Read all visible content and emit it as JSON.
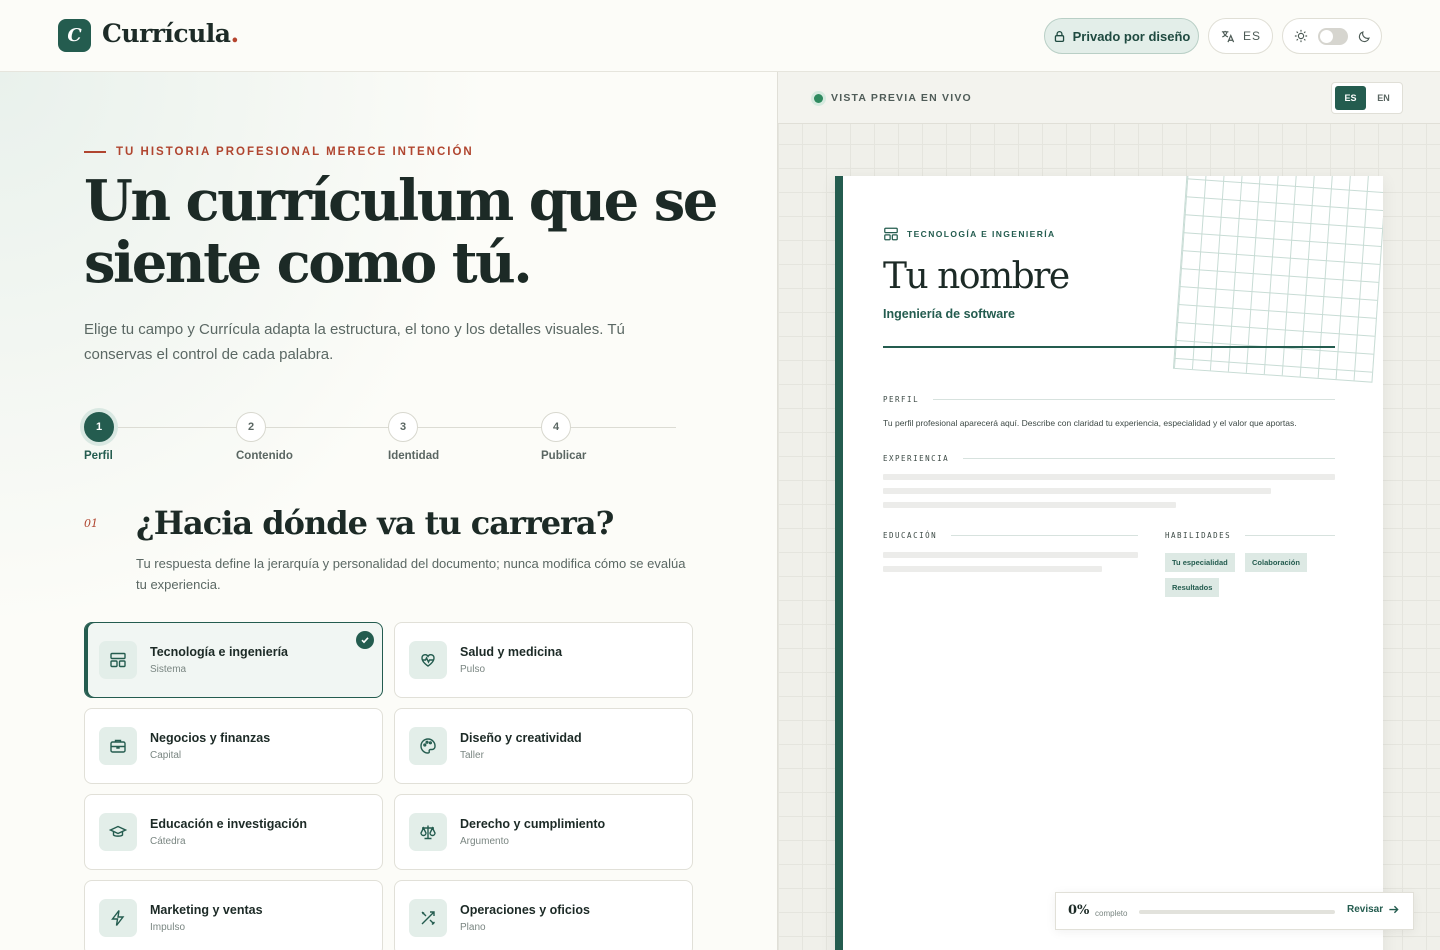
{
  "header": {
    "logo_mark": "C",
    "logo_text": "Currícula",
    "logo_dot": ".",
    "privacy_label": "Privado por diseño",
    "lang_code": "ES"
  },
  "hero": {
    "eyebrow": "TU HISTORIA PROFESIONAL MERECE INTENCIÓN",
    "title": "Un currículum que se siente como tú.",
    "subtitle": "Elige tu campo y Currícula adapta la estructura, el tono y los detalles visuales. Tú conservas el control de cada palabra."
  },
  "steps": [
    {
      "num": "1",
      "label": "Perfil",
      "active": true
    },
    {
      "num": "2",
      "label": "Contenido",
      "active": false
    },
    {
      "num": "3",
      "label": "Identidad",
      "active": false
    },
    {
      "num": "4",
      "label": "Publicar",
      "active": false
    }
  ],
  "question": {
    "num": "01",
    "title": "¿Hacia dónde va tu carrera?",
    "subtitle": "Tu respuesta define la jerarquía y personalidad del documento; nunca modifica cómo se evalúa tu experiencia."
  },
  "fields": [
    {
      "title": "Tecnología e ingeniería",
      "subtitle": "Sistema",
      "icon": "layout-icon",
      "selected": true
    },
    {
      "title": "Salud y medicina",
      "subtitle": "Pulso",
      "icon": "heart-pulse-icon",
      "selected": false
    },
    {
      "title": "Negocios y finanzas",
      "subtitle": "Capital",
      "icon": "briefcase-icon",
      "selected": false
    },
    {
      "title": "Diseño y creatividad",
      "subtitle": "Taller",
      "icon": "palette-icon",
      "selected": false
    },
    {
      "title": "Educación e investigación",
      "subtitle": "Cátedra",
      "icon": "graduation-cap-icon",
      "selected": false
    },
    {
      "title": "Derecho y cumplimiento",
      "subtitle": "Argumento",
      "icon": "scale-icon",
      "selected": false
    },
    {
      "title": "Marketing y ventas",
      "subtitle": "Impulso",
      "icon": "lightning-icon",
      "selected": false
    },
    {
      "title": "Operaciones y oficios",
      "subtitle": "Plano",
      "icon": "tools-icon",
      "selected": false
    }
  ],
  "preview": {
    "live_label": "VISTA PREVIA EN VIVO",
    "lang_options": [
      "ES",
      "EN"
    ],
    "lang_selected": "ES",
    "paper": {
      "field_label": "TECNOLOGÍA E INGENIERÍA",
      "name": "Tu nombre",
      "role": "Ingeniería de software",
      "profile_head": "PERFIL",
      "profile_text": "Tu perfil profesional aparecerá aquí. Describe con claridad tu experiencia, especialidad y el valor que aportas.",
      "experience_head": "EXPERIENCIA",
      "education_head": "EDUCACIÓN",
      "skills_head": "HABILIDADES",
      "skills": [
        "Tu especialidad",
        "Colaboración",
        "Resultados"
      ]
    },
    "progress": {
      "percent_label": "0%",
      "percent_value": 0,
      "caption": "completo",
      "action": "Revisar"
    }
  },
  "colors": {
    "brand": "#245c4f",
    "accent": "#b0452f",
    "background": "#fcfcf8"
  }
}
